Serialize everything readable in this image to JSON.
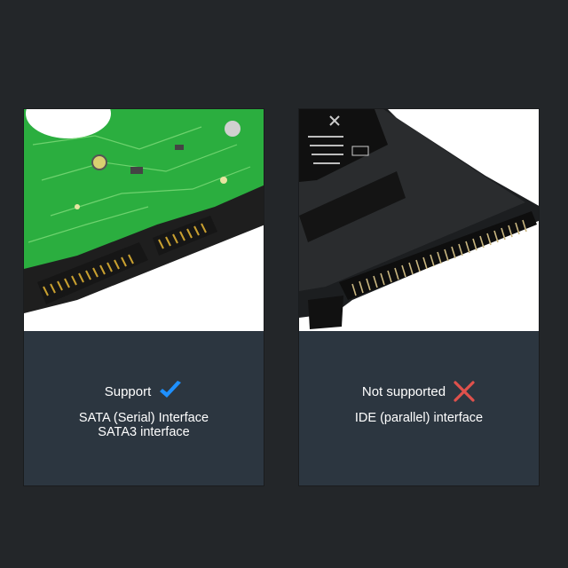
{
  "cards": [
    {
      "status": "Support",
      "status_icon": "check-icon",
      "status_color": "#1e90ff",
      "lines": [
        "SATA (Serial) Interface",
        "SATA3 interface"
      ]
    },
    {
      "status": "Not supported",
      "status_icon": "cross-icon",
      "status_color": "#e0514c",
      "lines": [
        "IDE (parallel) interface"
      ]
    }
  ],
  "colors": {
    "background": "#232629",
    "panel": "#2c3640",
    "pcb_green": "#2bae3f",
    "drive_black": "#1c1e20"
  }
}
